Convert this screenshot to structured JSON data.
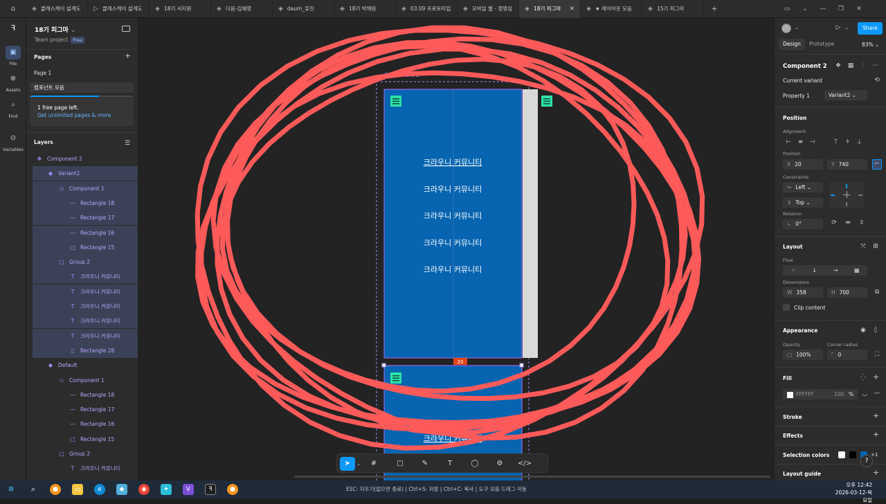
{
  "tabs": [
    {
      "icon": "figma-file-icon",
      "label": "클레스케이 설계도"
    },
    {
      "icon": "play-icon",
      "label": "클레스케이 설계도"
    },
    {
      "icon": "figma-file-icon",
      "label": "18기 서지원"
    },
    {
      "icon": "figma-file-icon",
      "label": "다음-김혜영"
    },
    {
      "icon": "figma-file-icon",
      "label": "daum_유진"
    },
    {
      "icon": "figma-file-icon",
      "label": "18기 박채원"
    },
    {
      "icon": "figma-file-icon",
      "label": "03.09 프로토타입"
    },
    {
      "icon": "figma-file-icon",
      "label": "모바일 웹 - 정영심"
    },
    {
      "icon": "figma-file-icon",
      "label": "18기 피그마",
      "active": true
    },
    {
      "icon": "figma-file-icon",
      "label": "★ 레이아웃 모음"
    },
    {
      "icon": "figma-file-icon",
      "label": "15기 피그마"
    }
  ],
  "rail": [
    {
      "name": "file",
      "label": "File",
      "active": true
    },
    {
      "name": "assets",
      "label": "Assets"
    },
    {
      "name": "find",
      "label": "Find"
    },
    {
      "name": "variables",
      "label": "Variables"
    }
  ],
  "project": {
    "title": "18기 피그마",
    "team": "Team project",
    "plan": "Free"
  },
  "pages": {
    "heading": "Pages",
    "items": [
      {
        "label": "Page 1"
      },
      {
        "label": "컴포넌트 모음",
        "selected": true
      }
    ],
    "upsell_line1": "1 free page left.",
    "upsell_line2": "Get unlimited pages & more"
  },
  "layers": {
    "heading": "Layers",
    "items": [
      {
        "icon": "❖",
        "label": "Component 2",
        "indent": 0,
        "hl": false
      },
      {
        "icon": "◆",
        "label": "Variant2",
        "indent": 1,
        "hl": true
      },
      {
        "icon": "◇",
        "label": "Component 1",
        "indent": 2,
        "hl": true
      },
      {
        "icon": "—",
        "label": "Rectangle 18",
        "indent": 3,
        "hl": true
      },
      {
        "icon": "—",
        "label": "Rectangle 17",
        "indent": 3,
        "hl": true
      },
      {
        "icon": "—",
        "label": "Rectangle 16",
        "indent": 3,
        "hl": true
      },
      {
        "icon": "□",
        "label": "Rectangle 15",
        "indent": 3,
        "hl": true
      },
      {
        "icon": "▢",
        "label": "Group 2",
        "indent": 2,
        "hl": true
      },
      {
        "icon": "T",
        "label": "크라우니 커뮤니티",
        "indent": 3,
        "hl": true
      },
      {
        "icon": "T",
        "label": "크라우니 커뮤니티",
        "indent": 3,
        "hl": true
      },
      {
        "icon": "T",
        "label": "크라우니 커뮤니티",
        "indent": 3,
        "hl": true
      },
      {
        "icon": "T",
        "label": "크라우니 커뮤니티",
        "indent": 3,
        "hl": true
      },
      {
        "icon": "T",
        "label": "크라우니 커뮤니티",
        "indent": 3,
        "hl": true
      },
      {
        "icon": "▯",
        "label": "Rectangle 28",
        "indent": 3,
        "hl": true
      },
      {
        "icon": "◆",
        "label": "Default",
        "indent": 1,
        "hl": false
      },
      {
        "icon": "◇",
        "label": "Component 1",
        "indent": 2,
        "hl": false
      },
      {
        "icon": "—",
        "label": "Rectangle 18",
        "indent": 3,
        "hl": false
      },
      {
        "icon": "—",
        "label": "Rectangle 17",
        "indent": 3,
        "hl": false
      },
      {
        "icon": "—",
        "label": "Rectangle 16",
        "indent": 3,
        "hl": false
      },
      {
        "icon": "□",
        "label": "Rectangle 15",
        "indent": 3,
        "hl": false
      },
      {
        "icon": "▢",
        "label": "Group 2",
        "indent": 2,
        "hl": false
      },
      {
        "icon": "T",
        "label": "크라우니 커뮤니티",
        "indent": 3,
        "hl": false
      }
    ]
  },
  "canvas": {
    "component_label": "Component 2",
    "menu_items": [
      "크라우니 커뮤니티",
      "크라우니 커뮤니티",
      "크라우니 커뮤니티",
      "크라우니 커뮤니티",
      "크라우니 커뮤니티"
    ],
    "lower_menu_item": "크라우니 커뮤니티",
    "gap_label": "20",
    "frame_color": "#0664b0",
    "scribble_color": "#ff5555"
  },
  "right": {
    "share": "Share",
    "tab_design": "Design",
    "tab_prototype": "Prototype",
    "zoom": "83%",
    "component_name": "Component 2",
    "current_variant": "Current variant",
    "property_label": "Property 1",
    "property_value": "Variant2",
    "position_h": "Position",
    "alignment_lbl": "Alignment",
    "position_lbl": "Position",
    "x_lbl": "X",
    "x_val": "20",
    "y_lbl": "Y",
    "y_val": "740",
    "constraints_lbl": "Constraints",
    "cons_h": "Left",
    "cons_v": "Top",
    "rotation_lbl": "Rotation",
    "rotation_val": "0°",
    "layout_h": "Layout",
    "flow_lbl": "Flow",
    "dimensions_lbl": "Dimensions",
    "w_lbl": "W",
    "w_val": "358",
    "h_lbl": "H",
    "h_val": "700",
    "clip_content": "Clip content",
    "appearance_h": "Appearance",
    "opacity_lbl": "Opacity",
    "opacity_val": "100%",
    "radius_lbl": "Corner radius",
    "radius_val": "0",
    "fill_h": "Fill",
    "fill_hex": "FFFFFF",
    "fill_opacity": "100",
    "fill_pct": "%",
    "stroke_h": "Stroke",
    "effects_h": "Effects",
    "selection_colors_h": "Selection colors",
    "selection_more": "+1",
    "layout_guide_h": "Layout guide"
  },
  "status": {
    "hint": "ESC: 지우기(없으면 종료) | Ctrl+S: 저장 | Ctrl+C: 복사 | 도구 모음 드래그 이동",
    "time": "오후 12:42",
    "date": "2026-03-12-목요일"
  },
  "help": "?"
}
